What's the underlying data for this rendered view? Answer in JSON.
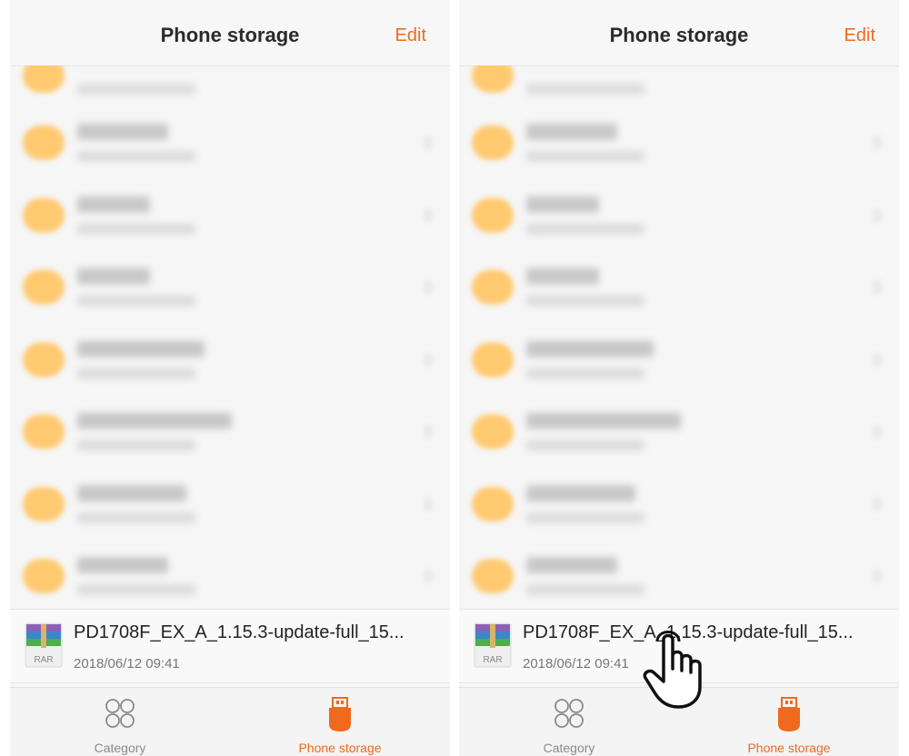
{
  "header": {
    "title": "Phone storage",
    "edit_label": "Edit"
  },
  "file": {
    "name": "PD1708F_EX_A_1.15.3-update-full_15...",
    "date": "2018/06/12 09:41",
    "icon_label": "RAR"
  },
  "bottom_nav": {
    "category_label": "Category",
    "phone_storage_label": "Phone storage"
  },
  "colors": {
    "accent": "#f06a1d",
    "folder": "#ffc970"
  },
  "icons": {
    "category": "four-circles-icon",
    "phone_storage": "usb-drive-icon",
    "file": "rar-archive-icon",
    "gesture": "tap-hand-icon"
  }
}
